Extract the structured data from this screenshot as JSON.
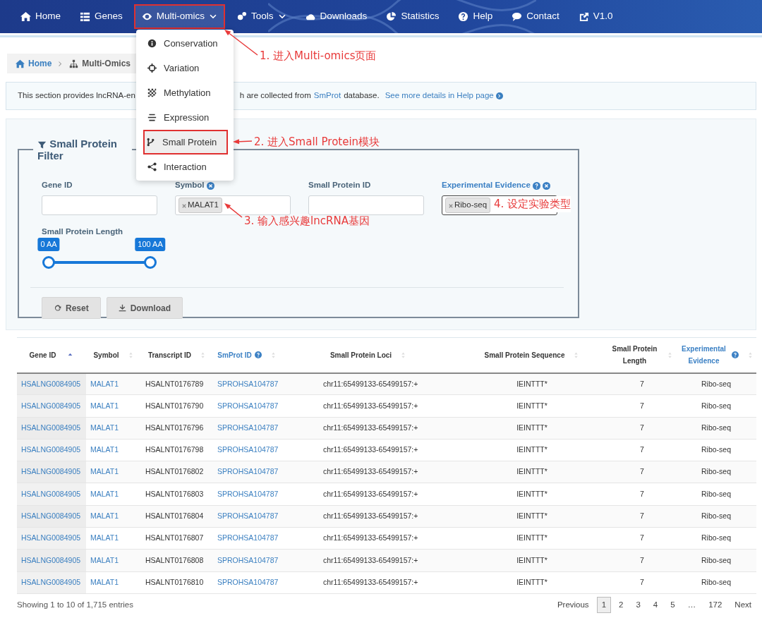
{
  "nav": {
    "items": [
      {
        "label": "Home",
        "caret": false,
        "selected": false,
        "marked": false
      },
      {
        "label": "Genes",
        "caret": false,
        "selected": false,
        "marked": false
      },
      {
        "label": "Multi-omics",
        "caret": true,
        "selected": true,
        "marked": true
      },
      {
        "label": "Tools",
        "caret": true,
        "selected": false,
        "marked": false
      },
      {
        "label": "Downloads",
        "caret": false,
        "selected": false,
        "marked": false
      },
      {
        "label": "Statistics",
        "caret": false,
        "selected": false,
        "marked": false
      },
      {
        "label": "Help",
        "caret": false,
        "selected": false,
        "marked": false
      },
      {
        "label": "Contact",
        "caret": false,
        "selected": false,
        "marked": false
      },
      {
        "label": "V1.0",
        "caret": false,
        "selected": false,
        "marked": false
      }
    ]
  },
  "dropdown": {
    "items": [
      {
        "label": "Conservation",
        "selected": false,
        "marked": false
      },
      {
        "label": "Variation",
        "selected": false,
        "marked": false
      },
      {
        "label": "Methylation",
        "selected": false,
        "marked": false
      },
      {
        "label": "Expression",
        "selected": false,
        "marked": false
      },
      {
        "label": "Small Protein",
        "selected": true,
        "marked": true
      },
      {
        "label": "Interaction",
        "selected": false,
        "marked": false
      }
    ]
  },
  "breadcrumb": [
    "Home",
    "Multi-Omics"
  ],
  "intro": {
    "text_start": "This section provides lncRNA-en",
    "text_resume": "h are collected from",
    "link": "SmProt",
    "text_end": "database.",
    "help_link": "See more details in Help page"
  },
  "filter": {
    "legend": "Small Protein Filter",
    "fields": [
      {
        "label": "Gene ID",
        "help": false,
        "clearable": false
      },
      {
        "label": "Symbol",
        "help": false,
        "clearable": true,
        "tags": [
          "MALAT1"
        ]
      },
      {
        "label": "Small Protein ID",
        "help": false,
        "clearable": false
      },
      {
        "label": "Experimental Evidence",
        "help": true,
        "clearable": true,
        "tags": [
          "Ribo-seq"
        ]
      }
    ],
    "slider": {
      "label": "Small Protein Length",
      "thumbs": [
        {
          "label": "0 AA",
          "level": 0
        },
        {
          "label": "100 AA",
          "level": 1
        }
      ]
    },
    "buttons": [
      "Reset",
      "Download"
    ]
  },
  "table": {
    "columns": [
      {
        "label": "Gene ID",
        "sorted": true,
        "help": false,
        "link": true
      },
      {
        "label": "Symbol",
        "sorted": false,
        "help": false,
        "link": true
      },
      {
        "label": "Transcript ID",
        "sorted": false,
        "help": false,
        "link": false
      },
      {
        "label": "SmProt ID",
        "sorted": false,
        "help": true,
        "link": true
      },
      {
        "label": "Small Protein Loci",
        "sorted": false,
        "help": false,
        "link": false
      },
      {
        "label": "Small Protein Sequence",
        "sorted": false,
        "help": false,
        "link": false
      },
      {
        "label": "Small Protein Length",
        "sorted": false,
        "help": false,
        "link": false
      },
      {
        "label": "Experimental Evidence",
        "sorted": false,
        "help": true,
        "link": false
      }
    ],
    "rows": [
      [
        "HSALNG0084905",
        "MALAT1",
        "HSALNT0176789",
        "SPROHSA104787",
        "chr11:65499133-65499157:+",
        "IEINTTT*",
        "7",
        "Ribo-seq"
      ],
      [
        "HSALNG0084905",
        "MALAT1",
        "HSALNT0176790",
        "SPROHSA104787",
        "chr11:65499133-65499157:+",
        "IEINTTT*",
        "7",
        "Ribo-seq"
      ],
      [
        "HSALNG0084905",
        "MALAT1",
        "HSALNT0176796",
        "SPROHSA104787",
        "chr11:65499133-65499157:+",
        "IEINTTT*",
        "7",
        "Ribo-seq"
      ],
      [
        "HSALNG0084905",
        "MALAT1",
        "HSALNT0176798",
        "SPROHSA104787",
        "chr11:65499133-65499157:+",
        "IEINTTT*",
        "7",
        "Ribo-seq"
      ],
      [
        "HSALNG0084905",
        "MALAT1",
        "HSALNT0176802",
        "SPROHSA104787",
        "chr11:65499133-65499157:+",
        "IEINTTT*",
        "7",
        "Ribo-seq"
      ],
      [
        "HSALNG0084905",
        "MALAT1",
        "HSALNT0176803",
        "SPROHSA104787",
        "chr11:65499133-65499157:+",
        "IEINTTT*",
        "7",
        "Ribo-seq"
      ],
      [
        "HSALNG0084905",
        "MALAT1",
        "HSALNT0176804",
        "SPROHSA104787",
        "chr11:65499133-65499157:+",
        "IEINTTT*",
        "7",
        "Ribo-seq"
      ],
      [
        "HSALNG0084905",
        "MALAT1",
        "HSALNT0176807",
        "SPROHSA104787",
        "chr11:65499133-65499157:+",
        "IEINTTT*",
        "7",
        "Ribo-seq"
      ],
      [
        "HSALNG0084905",
        "MALAT1",
        "HSALNT0176808",
        "SPROHSA104787",
        "chr11:65499133-65499157:+",
        "IEINTTT*",
        "7",
        "Ribo-seq"
      ],
      [
        "HSALNG0084905",
        "MALAT1",
        "HSALNT0176810",
        "SPROHSA104787",
        "chr11:65499133-65499157:+",
        "IEINTTT*",
        "7",
        "Ribo-seq"
      ]
    ]
  },
  "footer": {
    "info": "Showing 1 to 10 of 1,715 entries",
    "pages": [
      {
        "label": "Previous",
        "selected": false
      },
      {
        "label": "1",
        "selected": true
      },
      {
        "label": "2",
        "selected": false
      },
      {
        "label": "3",
        "selected": false
      },
      {
        "label": "4",
        "selected": false
      },
      {
        "label": "5",
        "selected": false
      },
      {
        "label": "…",
        "selected": false
      },
      {
        "label": "172",
        "selected": false
      },
      {
        "label": "Next",
        "selected": false
      }
    ]
  },
  "annotations": [
    "1. 进入Multi-omics页面",
    "2. 进入Small Protein模块",
    "3. 输入感兴趣lncRNA基因",
    "4. 设定实验类型"
  ]
}
